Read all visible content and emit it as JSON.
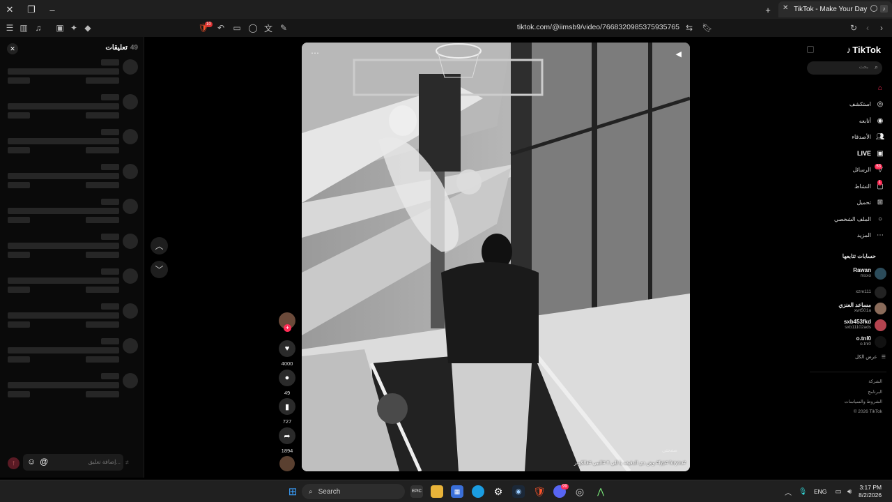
{
  "window": {
    "tab_title": "TikTok - Make Your Day"
  },
  "toolbar": {
    "url": "tiktok.com/@iimsb9/video/7668320985375935765",
    "shield_count": "10"
  },
  "comments": {
    "title": "تعليقات",
    "count": "49",
    "input_placeholder": "إضافة تعليق..."
  },
  "video": {
    "caption": "وش ذي الدقيقه يا للي !! #التبي #فالكونز #fyp# foryou#",
    "caption_bold": "foryou #fyp#",
    "watermark": "صفحتي"
  },
  "actions": {
    "likes": "4000",
    "comments": "49",
    "saves": "727",
    "shares": "1894"
  },
  "sidebar": {
    "brand": "TikTok",
    "search_placeholder": "بحث",
    "nav": [
      {
        "label": "",
        "icon": "home-icon"
      },
      {
        "label": "استكشف",
        "icon": "compass-icon"
      },
      {
        "label": "أتابعه",
        "icon": "following-icon"
      },
      {
        "label": "الأصدقاء",
        "icon": "friends-icon"
      },
      {
        "label": "LIVE",
        "icon": "live-icon"
      },
      {
        "label": "الرسائل",
        "icon": "messages-icon",
        "badge": "53"
      },
      {
        "label": "النشاط",
        "icon": "activity-icon",
        "badge": "1"
      },
      {
        "label": "تحميل",
        "icon": "upload-icon"
      },
      {
        "label": "الملف الشخصي",
        "icon": "profile-icon"
      },
      {
        "label": "المزيد",
        "icon": "more-icon"
      }
    ],
    "following_title": "حسابات تتابعها",
    "accounts": [
      {
        "name": "Rawan",
        "handle": "msxo"
      },
      {
        "name": "",
        "handle": "xzre111"
      },
      {
        "name": "مساعد العنزي",
        "handle": "xwt501a"
      },
      {
        "name": "sxb453fkd",
        "handle": "sxb11102ads"
      },
      {
        "name": "o.tnl0",
        "handle": "o.tnl0"
      }
    ],
    "see_all": "عرض الكل",
    "footer": [
      "الشركة",
      "البرنامج",
      "الشروط والسياسات",
      "© 2026 TikTok"
    ]
  },
  "taskbar": {
    "search_label": "Search",
    "language": "ENG",
    "time": "3:17 PM",
    "date": "8/2/2026",
    "discord_badge": "99"
  },
  "colors": {
    "accent": "#fe2c55",
    "background": "#000000"
  }
}
